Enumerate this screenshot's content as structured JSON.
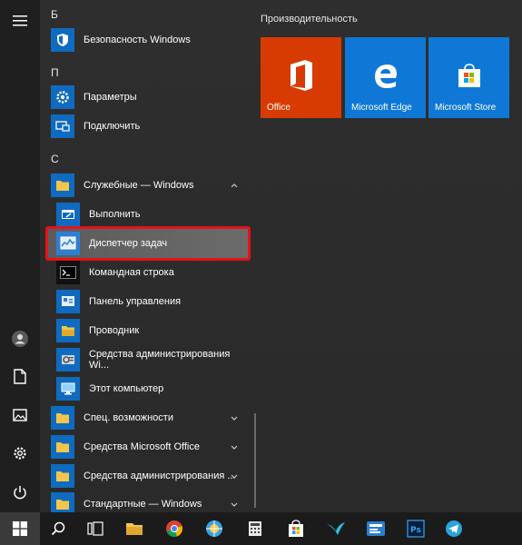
{
  "start_menu": {
    "groups": [
      {
        "letter": "Б",
        "apps": [
          {
            "label": "Безопасность Windows",
            "icon": "shield-icon"
          }
        ]
      },
      {
        "letter": "П",
        "apps": [
          {
            "label": "Параметры",
            "icon": "gear-icon"
          },
          {
            "label": "Подключить",
            "icon": "connect-icon"
          }
        ]
      },
      {
        "letter": "С",
        "apps": [
          {
            "label": "Служебные — Windows",
            "icon": "folder-icon",
            "expanded": true
          }
        ]
      }
    ],
    "folder_items": [
      {
        "label": "Выполнить",
        "icon": "run-icon"
      },
      {
        "label": "Диспетчер задач",
        "icon": "task-manager-icon",
        "selected": true
      },
      {
        "label": "Командная строка",
        "icon": "command-prompt-icon"
      },
      {
        "label": "Панель управления",
        "icon": "control-panel-icon"
      },
      {
        "label": "Проводник",
        "icon": "explorer-icon"
      },
      {
        "label": "Средства администрирования Wi...",
        "icon": "admin-tools-icon"
      },
      {
        "label": "Этот компьютер",
        "icon": "this-pc-icon"
      }
    ],
    "more_folders": [
      {
        "label": "Спец. возможности",
        "icon": "folder-icon"
      },
      {
        "label": "Средства Microsoft Office",
        "icon": "folder-icon"
      },
      {
        "label": "Средства администрирования ...",
        "icon": "folder-icon"
      },
      {
        "label": "Стандартные — Windows",
        "icon": "folder-icon"
      }
    ]
  },
  "tiles": {
    "group_title": "Производительность",
    "items": [
      {
        "label": "Office",
        "color": "#d83b01",
        "icon": "office-icon"
      },
      {
        "label": "Microsoft Edge",
        "color": "#0f78d7",
        "icon": "edge-icon"
      },
      {
        "label": "Microsoft Store",
        "color": "#0f78d7",
        "icon": "store-icon"
      }
    ]
  },
  "rail": [
    "hamburger-icon",
    "user-icon",
    "documents-icon",
    "pictures-icon",
    "settings-icon",
    "power-icon"
  ],
  "taskbar": [
    "windows-start-icon",
    "search-icon",
    "task-view-icon",
    "file-explorer-icon",
    "chrome-icon",
    "browser-icon",
    "calculator-icon",
    "store-icon",
    "bird-icon",
    "app-icon",
    "photoshop-icon",
    "telegram-icon"
  ],
  "colors": {
    "accent": "#0f6bbf",
    "highlight_border": "#e8101a"
  }
}
